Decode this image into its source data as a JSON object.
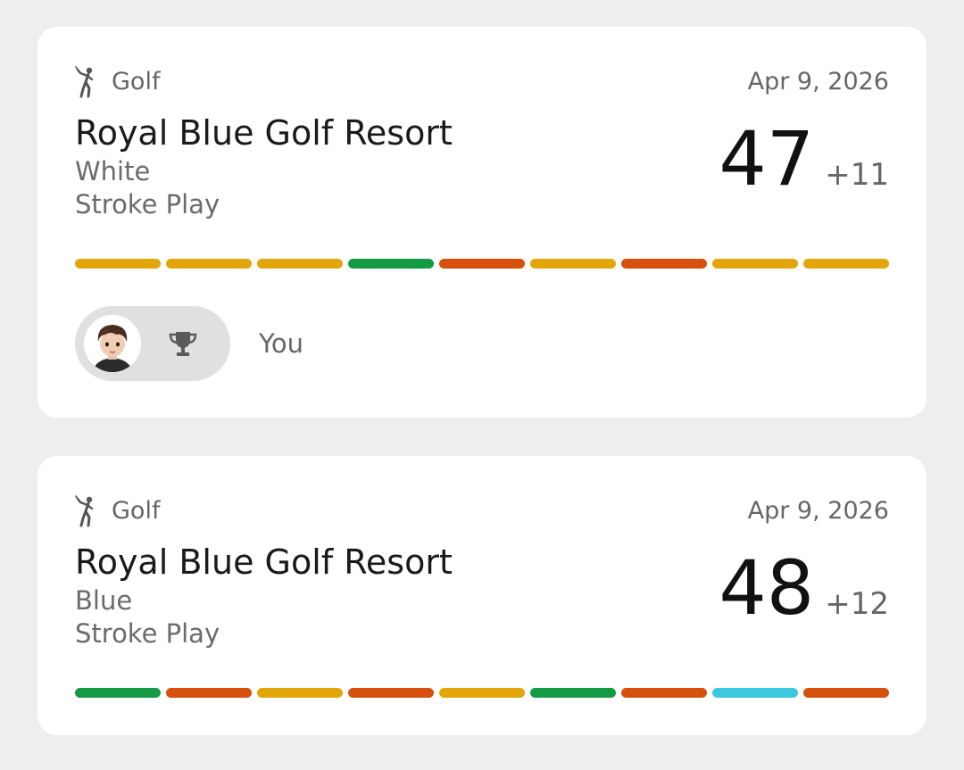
{
  "rounds": [
    {
      "sport": "Golf",
      "date": "Apr 9, 2026",
      "course": "Royal Blue Golf Resort",
      "tee": "White",
      "mode": "Stroke Play",
      "score": "47",
      "relative": "+11",
      "holes": [
        "#e2a60a",
        "#e2a60a",
        "#e2a60a",
        "#149a44",
        "#d6500e",
        "#e2a60a",
        "#d6500e",
        "#e2a60a",
        "#e2a60a"
      ],
      "player": {
        "name": "You",
        "avatar_icon": "avatar-image",
        "badge_icon": "trophy-icon"
      }
    },
    {
      "sport": "Golf",
      "date": "Apr 9, 2026",
      "course": "Royal Blue Golf Resort",
      "tee": "Blue",
      "mode": "Stroke Play",
      "score": "48",
      "relative": "+12",
      "holes": [
        "#149a44",
        "#d6500e",
        "#e2a60a",
        "#d6500e",
        "#e2a60a",
        "#149a44",
        "#d6500e",
        "#3cc8e0",
        "#d6500e"
      ]
    }
  ],
  "icons": {
    "sport": "golfer-icon"
  }
}
